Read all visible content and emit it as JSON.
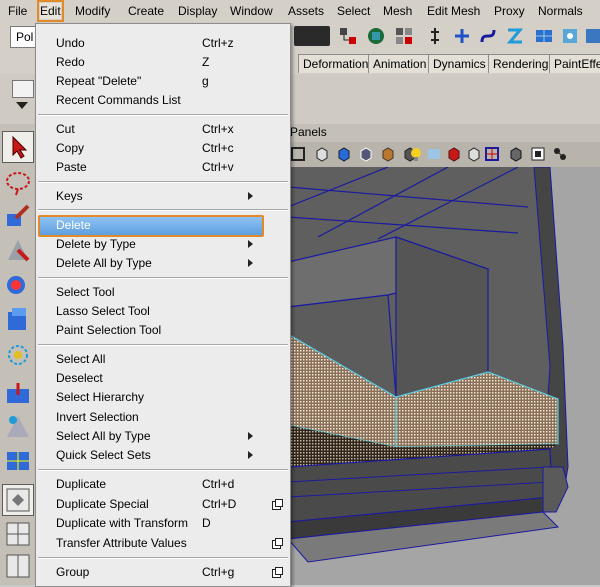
{
  "menubar": {
    "items": [
      {
        "label": "File"
      },
      {
        "label": "Edit"
      },
      {
        "label": "Modify"
      },
      {
        "label": "Create"
      },
      {
        "label": "Display"
      },
      {
        "label": "Window"
      },
      {
        "label": "Assets"
      },
      {
        "label": "Select"
      },
      {
        "label": "Mesh"
      },
      {
        "label": "Edit Mesh"
      },
      {
        "label": "Proxy"
      },
      {
        "label": "Normals"
      }
    ]
  },
  "toolbar": {
    "mode_field_value": "Pol"
  },
  "shelf_tabs": [
    {
      "label": "Deformation"
    },
    {
      "label": "Animation"
    },
    {
      "label": "Dynamics"
    },
    {
      "label": "Rendering"
    },
    {
      "label": "PaintEffec"
    }
  ],
  "panel": {
    "menu_label": "Panels"
  },
  "edit_menu": {
    "items": {
      "undo": {
        "label": "Undo",
        "shortcut": "Ctrl+z"
      },
      "redo": {
        "label": "Redo",
        "shortcut": "Z"
      },
      "repeat": {
        "label": "Repeat \"Delete\"",
        "shortcut": "g"
      },
      "recent": {
        "label": "Recent Commands List"
      },
      "cut": {
        "label": "Cut",
        "shortcut": "Ctrl+x"
      },
      "copy": {
        "label": "Copy",
        "shortcut": "Ctrl+c"
      },
      "paste": {
        "label": "Paste",
        "shortcut": "Ctrl+v"
      },
      "keys": {
        "label": "Keys"
      },
      "delete": {
        "label": "Delete"
      },
      "delete_by_type": {
        "label": "Delete by Type"
      },
      "delete_all_by_type": {
        "label": "Delete All by Type"
      },
      "select_tool": {
        "label": "Select Tool"
      },
      "lasso_tool": {
        "label": "Lasso Select Tool"
      },
      "paint_tool": {
        "label": "Paint Selection Tool"
      },
      "select_all": {
        "label": "Select All"
      },
      "deselect": {
        "label": "Deselect"
      },
      "select_hierarchy": {
        "label": "Select Hierarchy"
      },
      "invert": {
        "label": "Invert Selection"
      },
      "select_all_by_type": {
        "label": "Select All by Type"
      },
      "quick_sets": {
        "label": "Quick Select Sets"
      },
      "duplicate": {
        "label": "Duplicate",
        "shortcut": "Ctrl+d"
      },
      "duplicate_special": {
        "label": "Duplicate Special",
        "shortcut": "Ctrl+D"
      },
      "duplicate_transform": {
        "label": "Duplicate with Transform",
        "shortcut": "D"
      },
      "transfer": {
        "label": "Transfer Attribute Values"
      },
      "group": {
        "label": "Group",
        "shortcut": "Ctrl+g"
      }
    }
  },
  "colors": {
    "highlight_fill": "#5e9fe0",
    "highlight_border": "#e08a2a",
    "menu_bg": "#ececec",
    "mesh_wire": "#1a1aa0",
    "selection_wire": "#5ad0e0"
  }
}
